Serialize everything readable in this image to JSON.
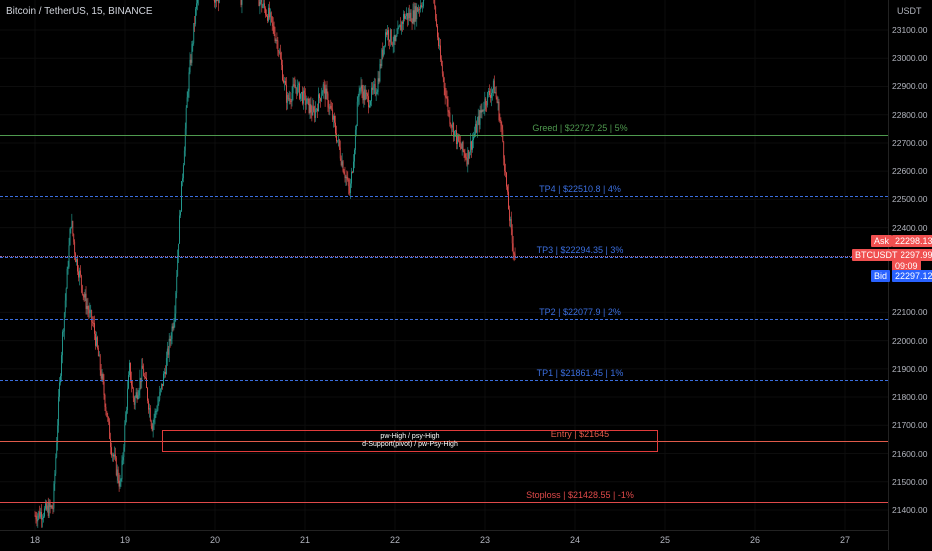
{
  "header": {
    "symbol_title": "Bitcoin / TetherUS, 15, BINANCE"
  },
  "price_axis": {
    "unit": "USDT",
    "ticks": [
      "23100.00",
      "23000.00",
      "22900.00",
      "22800.00",
      "22700.00",
      "22600.00",
      "22500.00",
      "22400.00",
      "22100.00",
      "22000.00",
      "21900.00",
      "21800.00",
      "21700.00",
      "21600.00",
      "21500.00",
      "21400.00"
    ],
    "tick_values": [
      23100,
      23000,
      22900,
      22800,
      22700,
      22600,
      22500,
      22400,
      22100,
      22000,
      21900,
      21800,
      21700,
      21600,
      21500,
      21400
    ]
  },
  "time_axis": {
    "ticks": [
      "18",
      "19",
      "20",
      "21",
      "22",
      "23",
      "24",
      "25",
      "26",
      "27"
    ]
  },
  "levels": {
    "greed": {
      "text": "Greed | $22727.25 | 5%",
      "price": 22727.25,
      "color": "#4f9a4f"
    },
    "tp4": {
      "text": "TP4 | $22510.8 | 4%",
      "price": 22510.8,
      "color": "#3b6fe0"
    },
    "tp3": {
      "text": "TP3 | $22294.35 | 3%",
      "price": 22294.35,
      "color": "#3b6fe0"
    },
    "tp2": {
      "text": "TP2 | $22077.9 | 2%",
      "price": 22077.9,
      "color": "#3b6fe0"
    },
    "tp1": {
      "text": "TP1 | $21861.45 | 1%",
      "price": 21861.45,
      "color": "#3b6fe0"
    },
    "entry": {
      "text": "Entry | $21645",
      "price": 21645,
      "color": "#e05a4a"
    },
    "stoploss": {
      "text": "Stoploss | $21428.55 | -1%",
      "price": 21428.55,
      "color": "#e04a4a"
    }
  },
  "quote": {
    "ask_label": "Ask",
    "ask_value": "22298.13",
    "symbol_label": "BTCUSDT",
    "last_value": "22297.99",
    "countdown": "09:09",
    "bid_label": "Bid",
    "bid_value": "22297.12",
    "ask_color": "#f05050",
    "bid_color": "#2962ff"
  },
  "zone": {
    "line1": "pw-High / psy-High",
    "line2": "d-Support(pivot) / pw-Psy-High",
    "price_high": 21685,
    "price_low": 21605
  },
  "chart_data": {
    "type": "candlestick",
    "symbol": "BTCUSDT",
    "interval": "15",
    "ylim": [
      21380,
      23200
    ],
    "x_ticks": [
      "18",
      "19",
      "20",
      "21",
      "22",
      "23",
      "24",
      "25",
      "26",
      "27"
    ],
    "path_close": [
      [
        0,
        21380
      ],
      [
        0.2,
        21410
      ],
      [
        0.25,
        21700
      ],
      [
        0.3,
        22000
      ],
      [
        0.35,
        22200
      ],
      [
        0.4,
        22430
      ],
      [
        0.45,
        22300
      ],
      [
        0.55,
        22150
      ],
      [
        0.65,
        22050
      ],
      [
        0.75,
        21850
      ],
      [
        0.85,
        21620
      ],
      [
        0.95,
        21480
      ],
      [
        1.0,
        21700
      ],
      [
        1.05,
        21900
      ],
      [
        1.1,
        21780
      ],
      [
        1.2,
        21900
      ],
      [
        1.3,
        21700
      ],
      [
        1.4,
        21820
      ],
      [
        1.5,
        22000
      ],
      [
        1.55,
        22100
      ],
      [
        1.62,
        22500
      ],
      [
        1.7,
        22900
      ],
      [
        1.78,
        23150
      ],
      [
        1.85,
        23300
      ],
      [
        1.95,
        23250
      ],
      [
        2.0,
        23200
      ],
      [
        2.1,
        23250
      ],
      [
        2.2,
        23300
      ],
      [
        2.3,
        23200
      ],
      [
        2.4,
        23300
      ],
      [
        2.5,
        23200
      ],
      [
        2.6,
        23150
      ],
      [
        2.7,
        23050
      ],
      [
        2.8,
        22850
      ],
      [
        2.9,
        22900
      ],
      [
        3.0,
        22850
      ],
      [
        3.1,
        22800
      ],
      [
        3.2,
        22900
      ],
      [
        3.3,
        22800
      ],
      [
        3.4,
        22650
      ],
      [
        3.5,
        22520
      ],
      [
        3.55,
        22700
      ],
      [
        3.6,
        22900
      ],
      [
        3.7,
        22850
      ],
      [
        3.8,
        22900
      ],
      [
        3.9,
        23100
      ],
      [
        4.0,
        23050
      ],
      [
        4.1,
        23150
      ],
      [
        4.2,
        23150
      ],
      [
        4.3,
        23200
      ],
      [
        4.4,
        23300
      ],
      [
        4.5,
        23000
      ],
      [
        4.6,
        22800
      ],
      [
        4.7,
        22700
      ],
      [
        4.8,
        22650
      ],
      [
        4.9,
        22750
      ],
      [
        5.0,
        22850
      ],
      [
        5.1,
        22900
      ],
      [
        5.15,
        22820
      ],
      [
        5.2,
        22700
      ],
      [
        5.25,
        22500
      ],
      [
        5.3,
        22350
      ],
      [
        5.34,
        22298
      ]
    ]
  }
}
